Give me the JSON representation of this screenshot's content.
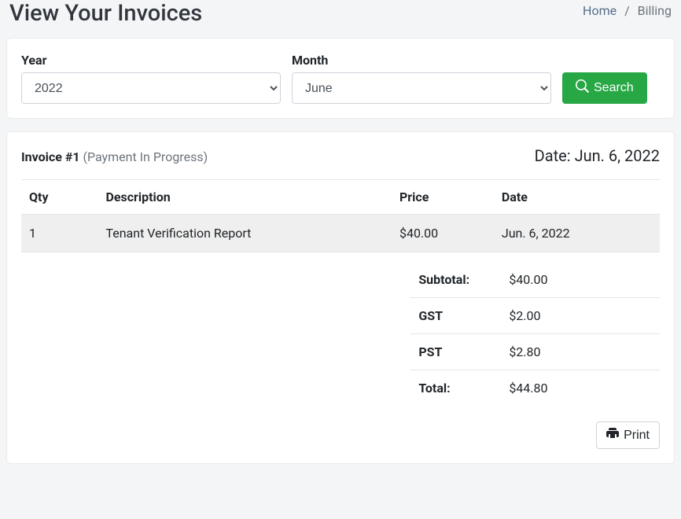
{
  "header": {
    "title": "View Your Invoices"
  },
  "breadcrumb": {
    "home": "Home",
    "current": "Billing"
  },
  "filters": {
    "year_label": "Year",
    "year_value": "2022",
    "month_label": "Month",
    "month_value": "June",
    "search_label": "Search"
  },
  "invoice": {
    "number_prefix": "Invoice #",
    "number": "1",
    "status": "(Payment In Progress)",
    "date_label": "Date: ",
    "date": "Jun. 6, 2022",
    "columns": {
      "qty": "Qty",
      "description": "Description",
      "price": "Price",
      "date": "Date"
    },
    "rows": [
      {
        "qty": "1",
        "description": "Tenant Verification Report",
        "price": "$40.00",
        "date": "Jun. 6, 2022"
      }
    ],
    "totals": {
      "subtotal_label": "Subtotal:",
      "subtotal": "$40.00",
      "gst_label": "GST",
      "gst": "$2.00",
      "pst_label": "PST",
      "pst": "$2.80",
      "total_label": "Total:",
      "total": "$44.80"
    }
  },
  "actions": {
    "print_label": "Print"
  }
}
